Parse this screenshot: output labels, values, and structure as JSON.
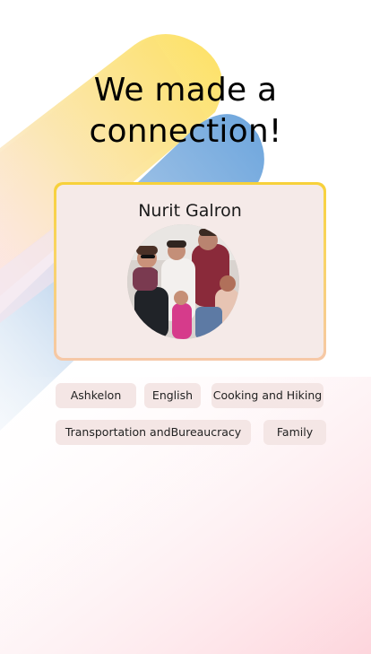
{
  "headline": {
    "line1": "We made a",
    "line2": "connection!"
  },
  "profile": {
    "name": "Nurit Galron",
    "photo_alt": "family group photo"
  },
  "tags": [
    "Ashkelon",
    "English",
    "Cooking and Hiking",
    "Transportation andBureaucracy",
    "Family"
  ],
  "colors": {
    "card_border_top": "#f7d13a",
    "card_border_bottom": "#f6c8a8",
    "card_fill": "#f5eae8",
    "chip_fill": "#f4e6e5",
    "yellow_blob": "#fbd84a",
    "blue_blob": "#5a9ad8",
    "pink_blob": "#f9c9d1"
  }
}
